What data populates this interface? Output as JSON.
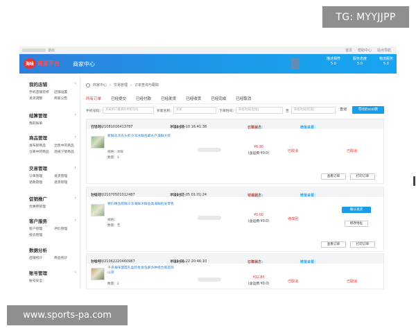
{
  "watermark": {
    "top": "TG: MYYJJPP",
    "bottom": "www.sports-pa.com"
  },
  "topbar": {
    "left_text": "退出",
    "right_links": [
      "首页",
      "帮助中心",
      "站点导航"
    ]
  },
  "header": {
    "logo_badge": "海味",
    "logo_text": "商家平台",
    "title": "商家中心",
    "stats": [
      {
        "label": "描述相符",
        "value": "5.0"
      },
      {
        "label": "服务态度",
        "value": "5.0"
      },
      {
        "label": "物流服务",
        "value": "5.0"
      }
    ],
    "colors": {
      "gradient_start": "#2f7fdc",
      "gradient_end": "#18a4f0",
      "accent_red": "#e52b2b"
    }
  },
  "sidebar": {
    "groups": [
      {
        "title": "我的店铺",
        "items": [
          "手机店铺装修",
          "店铺设置",
          "发货调整",
          "商家公告"
        ]
      },
      {
        "title": "结算管理",
        "items": [
          "我的账单"
        ]
      },
      {
        "title": "商品管理",
        "items": [
          "发布新商品",
          "出售中的商品",
          "仓库中的商品",
          "违规下架商品"
        ]
      },
      {
        "title": "交易管理",
        "items": [
          "订单管理",
          "发货管理",
          "退款管理",
          "退货管理"
        ]
      },
      {
        "title": "促销推广",
        "items": [
          "优惠券管理"
        ]
      },
      {
        "title": "客户服务",
        "items": [
          "客户管理",
          "评价管理",
          "投诉管理"
        ]
      },
      {
        "title": "数据分析",
        "items": [
          "店铺统计",
          "商品统计"
        ]
      },
      {
        "title": "账号管理",
        "items": [
          "账号安全"
        ]
      }
    ]
  },
  "breadcrumb": [
    "商家中心",
    "交易管理",
    "订单查询与跟踪"
  ],
  "tabs": [
    "所有订单",
    "已经提交",
    "已经付款",
    "已经发货",
    "已经收货",
    "已经完成",
    "已经取消"
  ],
  "filters": {
    "phone_label": "手机号码：",
    "phone_placeholder": "买家用户邀请的手机号码",
    "buyer_label": "买家名称：",
    "buyer_placeholder": "买家",
    "time_label": "下单时间：",
    "time_start_placeholder": "开始时间[起始]",
    "time_sep": "至",
    "time_end_placeholder": "开始时间[结束]",
    "search_label": "查询",
    "export_label": "导出Excel表"
  },
  "orders": [
    {
      "order_no_label": "订单号：",
      "order_no": "7772021081016413787",
      "time_label": "下单时间：",
      "time": "2021-08-10 16:41:38",
      "state_label": "订单状态：",
      "state": "已取消",
      "source_label": "订单来源：",
      "source": "微信订单",
      "product_title": "新鲜冰冻去头虾冷冻冰鲜包邮水产海鲜大虾",
      "spec_label": "规格：",
      "spec": "冰鲜",
      "qty_label": "数量：",
      "qty": "3",
      "price": "¥6.90",
      "shipping": "(含运费:¥0.0)",
      "status_mid": "已取消",
      "status_right": "已取消",
      "buttons": [
        "查看订单",
        "打印订单"
      ]
    },
    {
      "order_no_label": "订单号：",
      "order_no": "54312021070501012487",
      "time_label": "下单时间：",
      "time": "2021-07-05 01:01:24",
      "state_label": "订单状态：",
      "state": "待成团",
      "source_label": "订单来源：",
      "source": "微信订单",
      "product_title": "特价精品新鲜冷冻海鲜冰鲜鱼类海鲜批发零售",
      "spec_label": "规格：",
      "spec": "",
      "qty_label": "数量：",
      "qty": "无",
      "price": "¥0.00",
      "shipping": "(含运费:¥0.0)",
      "status_mid": "待成团",
      "action_primary": "确认发货",
      "action_secondary": "修改地址",
      "buttons": [
        "查看订单",
        "打印订单"
      ]
    },
    {
      "order_no_label": "订单号：",
      "order_no": "54042021062220460987",
      "time_label": "下单时间：",
      "time": "2021-06-22 20:46:10",
      "state_label": "订单状态：",
      "state": "已取消",
      "source_label": "订单来源：",
      "source": "微信订单",
      "product_title": "干货海味菌菇礼盒装批发包邮多种组合家庭装山货",
      "qty_label": "数量：",
      "qty": "2",
      "price": "¥32.80",
      "shipping": "(含运费:¥0.0)",
      "status_mid": "已取消",
      "status_right": "已取消"
    }
  ]
}
